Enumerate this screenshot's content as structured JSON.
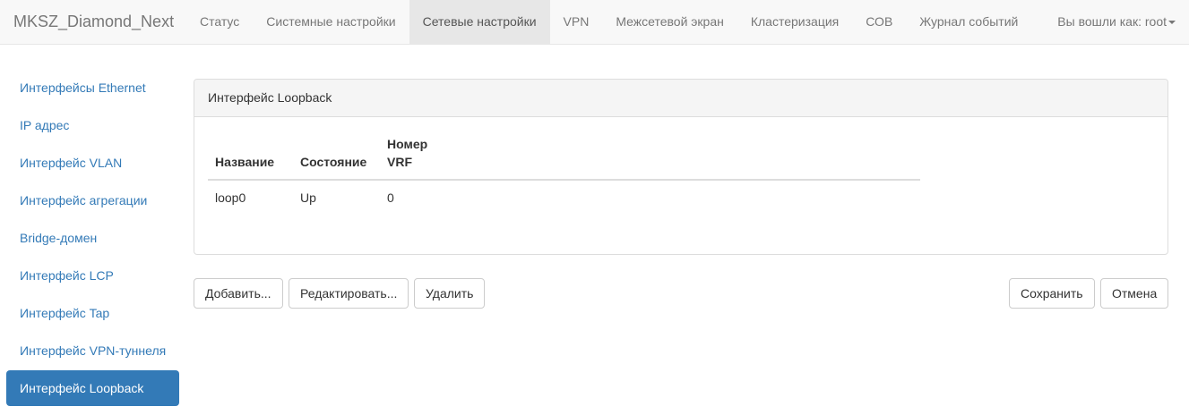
{
  "navbar": {
    "brand": "MKSZ_Diamond_Next",
    "items": [
      {
        "label": "Статус",
        "active": false
      },
      {
        "label": "Системные настройки",
        "active": false
      },
      {
        "label": "Сетевые настройки",
        "active": true
      },
      {
        "label": "VPN",
        "active": false
      },
      {
        "label": "Межсетевой экран",
        "active": false
      },
      {
        "label": "Кластеризация",
        "active": false
      },
      {
        "label": "СОВ",
        "active": false
      },
      {
        "label": "Журнал событий",
        "active": false
      }
    ],
    "user_label": "Вы вошли как: root"
  },
  "sidebar": {
    "items": [
      {
        "label": "Интерфейсы Ethernet",
        "active": false
      },
      {
        "label": "IP адрес",
        "active": false
      },
      {
        "label": "Интерфейс VLAN",
        "active": false
      },
      {
        "label": "Интерфейс агрегации",
        "active": false
      },
      {
        "label": "Bridge-домен",
        "active": false
      },
      {
        "label": "Интерфейс LCP",
        "active": false
      },
      {
        "label": "Интерфейс Tap",
        "active": false
      },
      {
        "label": "Интерфейс VPN-туннеля",
        "active": false
      },
      {
        "label": "Интерфейс Loopback",
        "active": true
      }
    ]
  },
  "panel": {
    "title": "Интерфейс Loopback",
    "table": {
      "headers": {
        "name": "Название",
        "state": "Состояние",
        "vrf_line1": "Номер",
        "vrf_line2": "VRF"
      },
      "rows": [
        {
          "name": "loop0",
          "state": "Up",
          "vrf": "0"
        }
      ]
    }
  },
  "actions": {
    "add": "Добавить...",
    "edit": "Редактировать...",
    "delete": "Удалить",
    "save": "Сохранить",
    "cancel": "Отмена"
  },
  "colors": {
    "accent": "#337ab7",
    "navbar_bg": "#f8f8f8",
    "nav_text": "#777777"
  }
}
